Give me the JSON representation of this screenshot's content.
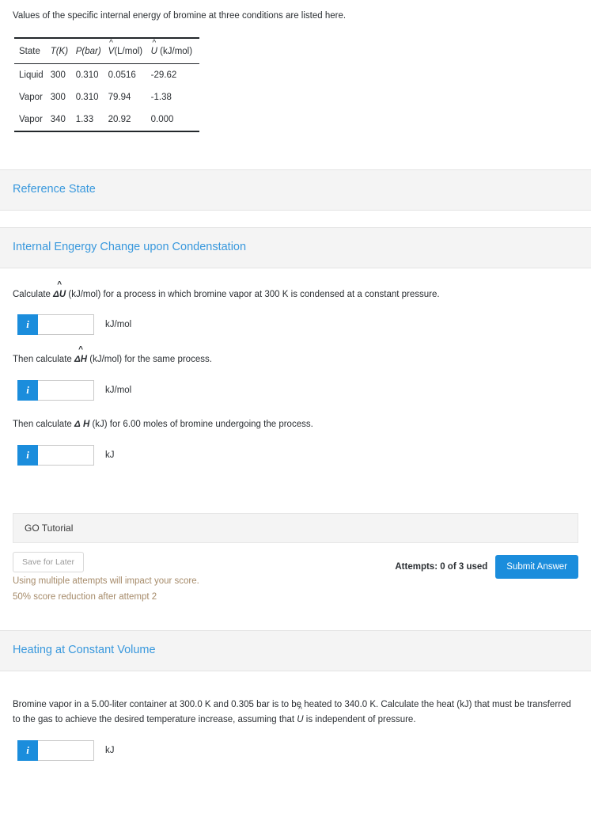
{
  "intro": {
    "text": "Values of the specific internal energy of bromine at three conditions are listed here."
  },
  "table": {
    "headers": {
      "state": "State",
      "temperature": "T(K)",
      "pressure": "P(bar)",
      "volume_var": "V",
      "volume_unit": "(L/mol)",
      "energy_var": "U",
      "energy_unit": "(kJ/mol)",
      "hat": "^"
    },
    "rows": [
      {
        "state": "Liquid",
        "T": "300",
        "P": "0.310",
        "V": "0.0516",
        "U": "-29.62"
      },
      {
        "state": "Vapor",
        "T": "300",
        "P": "0.310",
        "V": "79.94",
        "U": "-1.38"
      },
      {
        "state": "Vapor",
        "T": "340",
        "P": "1.33",
        "V": "20.92",
        "U": "0.000"
      }
    ]
  },
  "sections": {
    "reference_state": {
      "title": "Reference State"
    },
    "condensation": {
      "title": "Internal Engergy Change upon Condenstation"
    },
    "heating": {
      "title": "Heating at Constant Volume"
    }
  },
  "condensation": {
    "q1_pre": "Calculate",
    "q1_delta": "Δ",
    "q1_var": "U",
    "q1_hat": "^",
    "q1_post": "(kJ/mol) for a process in which bromine vapor at 300 K is condensed at a constant pressure.",
    "q1_unit": "kJ/mol",
    "q1_value": "",
    "q1_info": "i",
    "q2_pre": "Then calculate",
    "q2_delta": "Δ",
    "q2_var": "H",
    "q2_hat": "^",
    "q2_post": "(kJ/mol) for the same process.",
    "q2_unit": "kJ/mol",
    "q2_value": "",
    "q2_info": "i",
    "q3_pre": "Then calculate",
    "q3_delta": "Δ",
    "q3_var": "H",
    "q3_post": "(kJ) for 6.00 moles of bromine undergoing the process.",
    "q3_unit": "kJ",
    "q3_value": "",
    "q3_info": "i",
    "tutorial_label": "GO Tutorial",
    "save_later_label": "Save for Later",
    "warn_line1": "Using multiple attempts will impact your score.",
    "warn_line2": "50% score reduction after attempt 2",
    "attempts_label": "Attempts: 0 of 3 used",
    "submit_label": "Submit Answer"
  },
  "heating": {
    "q_line1": "Bromine vapor in a 5.00-liter container at 300.0 K and 0.305 bar is to be heated to 340.0 K. Calculate the heat (kJ) that must be",
    "q_line2_pre": "transferred to the gas to achieve the desired temperature increase, assuming that",
    "q_var": "U",
    "q_hat": "^",
    "q_line2_post": "is independent of pressure.",
    "q_unit": "kJ",
    "q_value": "",
    "q_info": "i"
  },
  "colors": {
    "accent_blue": "#1b8ddc",
    "section_title_blue": "#3898dd",
    "warn_brown": "#a68b6a",
    "section_bg": "#f4f4f4"
  }
}
